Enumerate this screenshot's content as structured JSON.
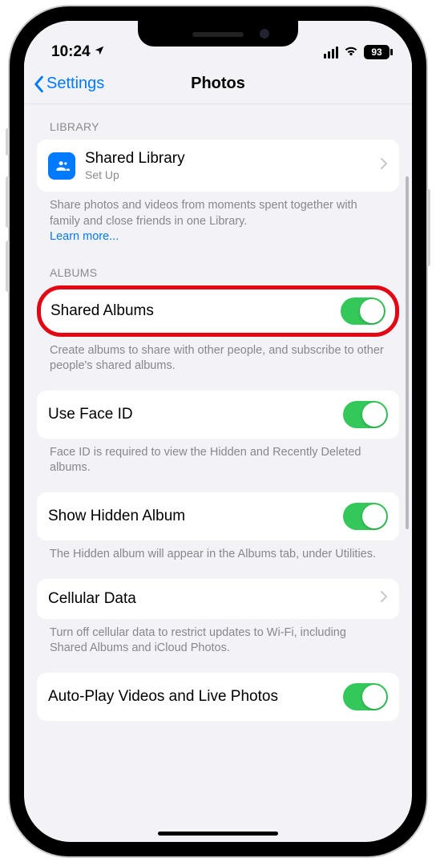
{
  "statusbar": {
    "time": "10:24",
    "battery": "93"
  },
  "nav": {
    "back": "Settings",
    "title": "Photos"
  },
  "library": {
    "header": "LIBRARY",
    "title": "Shared Library",
    "sub": "Set Up",
    "footer": "Share photos and videos from moments spent together with family and close friends in one Library.",
    "learnmore": "Learn more..."
  },
  "albums": {
    "header": "ALBUMS",
    "shared": "Shared Albums",
    "sharedFooter": "Create albums to share with other people, and subscribe to other people's shared albums.",
    "faceid": "Use Face ID",
    "faceidFooter": "Face ID is required to view the Hidden and Recently Deleted albums.",
    "hidden": "Show Hidden Album",
    "hiddenFooter": "The Hidden album will appear in the Albums tab, under Utilities.",
    "cellular": "Cellular Data",
    "cellularFooter": "Turn off cellular data to restrict updates to Wi-Fi, including Shared Albums and iCloud Photos.",
    "autoplay": "Auto-Play Videos and Live Photos"
  }
}
